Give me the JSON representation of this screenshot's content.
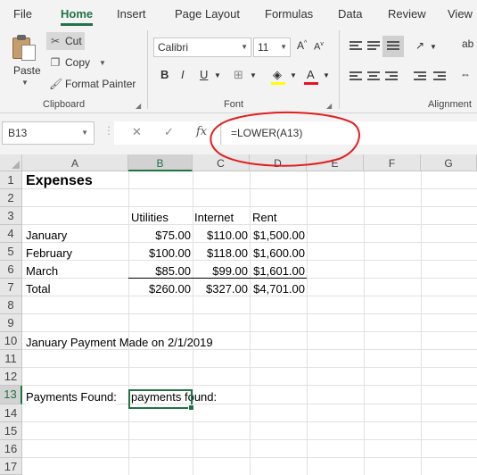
{
  "menu": {
    "tabs": [
      "File",
      "Home",
      "Insert",
      "Page Layout",
      "Formulas",
      "Data",
      "Review",
      "View"
    ],
    "active": "Home"
  },
  "ribbon": {
    "clipboard": {
      "paste": "Paste",
      "cut": "Cut",
      "copy": "Copy",
      "format_painter": "Format Painter",
      "group_label": "Clipboard"
    },
    "font": {
      "font_name": "Calibri",
      "font_size": "11",
      "bold": "B",
      "italic": "I",
      "underline": "U",
      "grow": "A",
      "shrink": "A",
      "font_color_glyph": "A",
      "fill_color": "#ffff00",
      "font_color": "#e81123",
      "group_label": "Font"
    },
    "alignment": {
      "group_label": "Alignment",
      "wrap_glyph": "ab"
    }
  },
  "formula_bar": {
    "name_box": "B13",
    "fx": "fx",
    "formula": "=LOWER(A13)",
    "annotation_color": "#e02020"
  },
  "sheet": {
    "columns": [
      "A",
      "B",
      "C",
      "D",
      "E",
      "F",
      "G"
    ],
    "selected_column": "B",
    "rows": [
      "1",
      "2",
      "3",
      "4",
      "5",
      "6",
      "7",
      "8",
      "9",
      "10",
      "11",
      "12",
      "13",
      "14",
      "15",
      "16",
      "17"
    ],
    "selected_row": "13",
    "title": "Expenses",
    "headers": {
      "b": "Utilities",
      "c": "Internet",
      "d": "Rent"
    },
    "data": [
      {
        "label": "January",
        "b": "$75.00",
        "c": "$110.00",
        "d": "$1,500.00"
      },
      {
        "label": "February",
        "b": "$100.00",
        "c": "$118.00",
        "d": "$1,600.00"
      },
      {
        "label": "March",
        "b": "$85.00",
        "c": "$99.00",
        "d": "$1,601.00"
      },
      {
        "label": "Total",
        "b": "$260.00",
        "c": "$327.00",
        "d": "$4,701.00"
      }
    ],
    "payment_note": "January Payment Made on 2/1/2019",
    "a13": "Payments Found:",
    "b13": "payments found:",
    "accent": "#217346"
  }
}
